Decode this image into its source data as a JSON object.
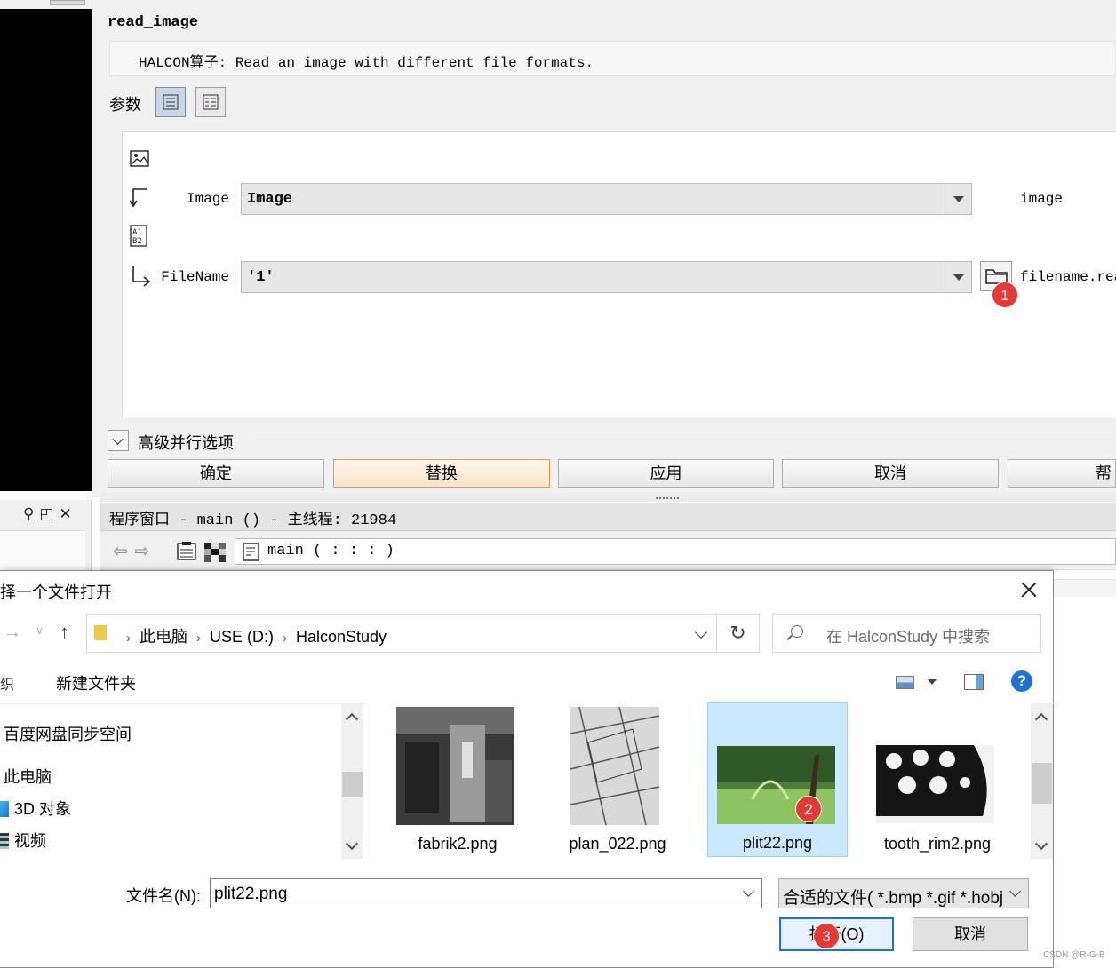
{
  "operator": {
    "name": "read_image",
    "description": "HALCON算子: Read an image with different file formats.",
    "params_label": "参数",
    "params": [
      {
        "label": "Image",
        "value": "Image",
        "type": "image"
      },
      {
        "label": "FileName",
        "value": "'1'",
        "type": "filename.read"
      }
    ],
    "advanced_label": "高级并行选项",
    "buttons": {
      "ok": "确定",
      "replace": "替换",
      "apply": "应用",
      "cancel": "取消",
      "help": "帮"
    }
  },
  "program_window": {
    "title": "程序窗口 - main () - 主线程: 21984",
    "procedure": "main ( : : : )"
  },
  "dialog": {
    "title": "择一个文件打开",
    "breadcrumb": [
      "此电脑",
      "USE (D:)",
      "HalconStudy"
    ],
    "search_placeholder": "在 HalconStudy 中搜索",
    "organize_fragment": "织",
    "new_folder": "新建文件夹",
    "nav_items": [
      "百度网盘同步空间",
      "此电脑",
      "3D 对象",
      "视频"
    ],
    "files": [
      {
        "name": "fabrik2.png",
        "selected": false
      },
      {
        "name": "plan_022.png",
        "selected": false
      },
      {
        "name": "plit22.png",
        "selected": true
      },
      {
        "name": "tooth_rim2.png",
        "selected": false
      }
    ],
    "filename_label": "文件名(N):",
    "filename_value": "plit22.png",
    "filter_value": "合适的文件( *.bmp *.gif *.hobj",
    "open_label": "打开(O)",
    "cancel_label": "取消"
  },
  "badges": [
    "1",
    "2",
    "3"
  ],
  "watermark": "CSDN @R-G-B",
  "colors": {
    "badge": "#e53935",
    "selection": "#cce8ff",
    "accent": "#1b74d4"
  }
}
